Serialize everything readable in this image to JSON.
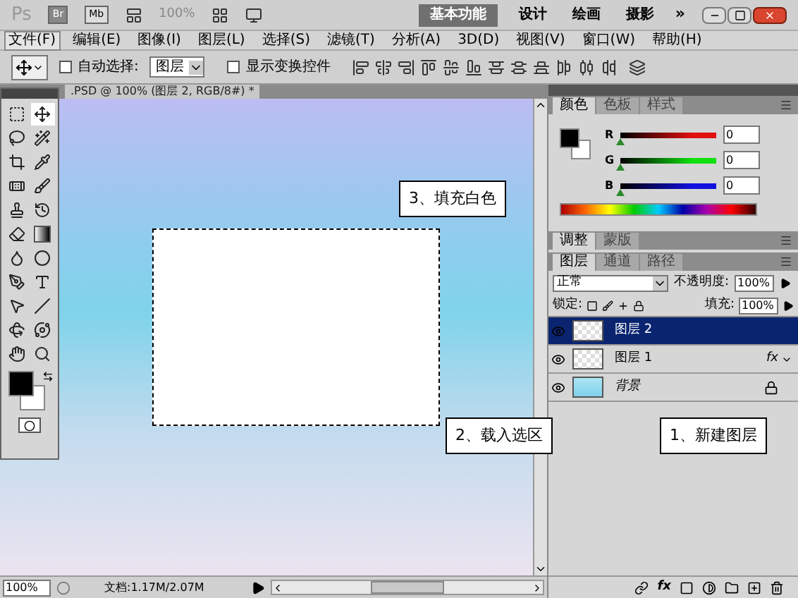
{
  "app_bar": {
    "logo": "Ps",
    "bridge": "Br",
    "mini_bridge": "Mb",
    "zoom": "100%",
    "more": "»",
    "workspaces": [
      {
        "label": "基本功能",
        "selected": true
      },
      {
        "label": "设计",
        "selected": false
      },
      {
        "label": "绘画",
        "selected": false
      },
      {
        "label": "摄影",
        "selected": false
      }
    ]
  },
  "menu": [
    {
      "label": "文件(F)",
      "selected": true
    },
    {
      "label": "编辑(E)",
      "selected": false
    },
    {
      "label": "图像(I)",
      "selected": false
    },
    {
      "label": "图层(L)",
      "selected": false
    },
    {
      "label": "选择(S)",
      "selected": false
    },
    {
      "label": "滤镜(T)",
      "selected": false
    },
    {
      "label": "分析(A)",
      "selected": false
    },
    {
      "label": "3D(D)",
      "selected": false
    },
    {
      "label": "视图(V)",
      "selected": false
    },
    {
      "label": "窗口(W)",
      "selected": false
    },
    {
      "label": "帮助(H)",
      "selected": false
    }
  ],
  "options_bar": {
    "auto_select": {
      "label": "自动选择:",
      "checked": false,
      "value": "图层"
    },
    "show_transform": {
      "label": "显示变换控件",
      "checked": false
    }
  },
  "document": {
    "tab": ".PSD @ 100% (图层 2, RGB/8#) *",
    "zoom": "100%",
    "doc_info": "文档:1.17M/2.07M"
  },
  "color_panel": {
    "tabs": [
      {
        "label": "颜色",
        "selected": true
      },
      {
        "label": "色板",
        "selected": false
      },
      {
        "label": "样式",
        "selected": false
      }
    ],
    "channels": [
      {
        "name": "R",
        "value": "0",
        "color": "#e01010",
        "level": 0
      },
      {
        "name": "G",
        "value": "0",
        "color": "#10e010",
        "level": 0
      },
      {
        "name": "B",
        "value": "0",
        "color": "#1010e0",
        "level": 0
      }
    ]
  },
  "adjust_tabs": [
    {
      "label": "调整",
      "selected": true
    },
    {
      "label": "蒙版",
      "selected": false
    }
  ],
  "layers_panel": {
    "tabs": [
      {
        "label": "图层",
        "selected": true
      },
      {
        "label": "通道",
        "selected": false
      },
      {
        "label": "路径",
        "selected": false
      }
    ],
    "blend_mode": "正常",
    "opacity_label": "不透明度:",
    "opacity": "100%",
    "lock_label": "锁定:",
    "fill_label": "填充:",
    "fill": "100%",
    "footer_fx": "fx",
    "layers": [
      {
        "name": "图层 2",
        "selected": true,
        "kind": "transparent",
        "locked": false
      },
      {
        "name": "图层 1",
        "selected": false,
        "kind": "transparent",
        "effects": "fx",
        "locked": false
      },
      {
        "name": "背景",
        "selected": false,
        "kind": "gradient",
        "locked": true
      }
    ]
  },
  "callouts": [
    {
      "text": "3、填充白色"
    },
    {
      "text": "2、载入选区"
    },
    {
      "text": "1、新建图层"
    }
  ]
}
